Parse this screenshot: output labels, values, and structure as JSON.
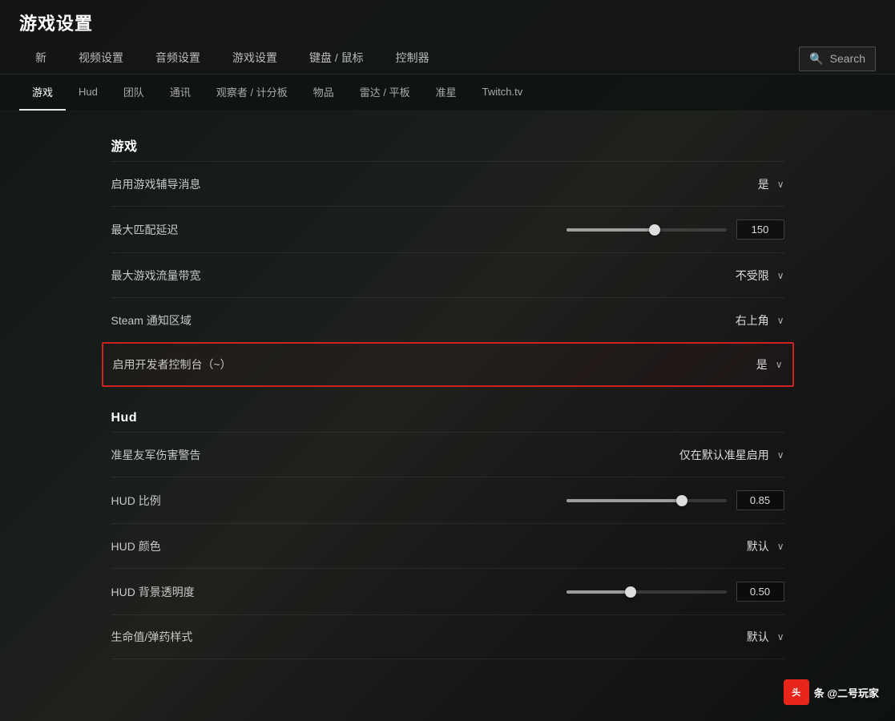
{
  "app": {
    "title": "游戏设置"
  },
  "nav": {
    "items": [
      {
        "id": "new",
        "label": "新"
      },
      {
        "id": "video",
        "label": "视频设置"
      },
      {
        "id": "audio",
        "label": "音频设置"
      },
      {
        "id": "game",
        "label": "游戏设置"
      },
      {
        "id": "keyboard",
        "label": "键盘 / 鼠标"
      },
      {
        "id": "controller",
        "label": "控制器"
      }
    ],
    "search_placeholder": "Search"
  },
  "sub_nav": {
    "items": [
      {
        "id": "game",
        "label": "游戏",
        "active": true
      },
      {
        "id": "hud",
        "label": "Hud"
      },
      {
        "id": "team",
        "label": "团队"
      },
      {
        "id": "comms",
        "label": "通讯"
      },
      {
        "id": "observer",
        "label": "观察者 / 计分板"
      },
      {
        "id": "items",
        "label": "物品"
      },
      {
        "id": "radar",
        "label": "雷达 / 平板"
      },
      {
        "id": "crosshair",
        "label": "准星"
      },
      {
        "id": "twitch",
        "label": "Twitch.tv"
      }
    ]
  },
  "sections": [
    {
      "id": "game-section",
      "header": "游戏",
      "rows": [
        {
          "id": "game-assistant",
          "label": "启用游戏辅导消息",
          "type": "dropdown",
          "value": "是",
          "highlighted": false
        },
        {
          "id": "max-matchmaking-delay",
          "label": "最大匹配延迟",
          "type": "slider",
          "slider_fill_pct": 55,
          "slider_thumb_pct": 55,
          "value": "150",
          "highlighted": false
        },
        {
          "id": "max-game-bandwidth",
          "label": "最大游戏流量带宽",
          "type": "dropdown",
          "value": "不受限",
          "highlighted": false
        },
        {
          "id": "steam-notification",
          "label": "Steam 通知区域",
          "type": "dropdown",
          "value": "右上角",
          "highlighted": false
        },
        {
          "id": "developer-console",
          "label": "启用开发者控制台（~）",
          "type": "dropdown",
          "value": "是",
          "highlighted": true
        }
      ]
    },
    {
      "id": "hud-section",
      "header": "Hud",
      "rows": [
        {
          "id": "crosshair-warning",
          "label": "准星友军伤害警告",
          "type": "dropdown",
          "value": "仅在默认准星启用",
          "highlighted": false
        },
        {
          "id": "hud-scale",
          "label": "HUD 比例",
          "type": "slider",
          "slider_fill_pct": 72,
          "slider_thumb_pct": 72,
          "value": "0.85",
          "highlighted": false
        },
        {
          "id": "hud-color",
          "label": "HUD 颜色",
          "type": "dropdown",
          "value": "默认",
          "highlighted": false
        },
        {
          "id": "hud-bg-transparency",
          "label": "HUD 背景透明度",
          "type": "slider",
          "slider_fill_pct": 40,
          "slider_thumb_pct": 40,
          "value": "0.50",
          "highlighted": false
        },
        {
          "id": "health-ammo-style",
          "label": "生命值/弹药样式",
          "type": "dropdown",
          "value": "默认",
          "highlighted": false
        }
      ]
    }
  ],
  "watermark": {
    "icon": "头",
    "text": "条 @二号玩家"
  },
  "icons": {
    "search": "🔍",
    "chevron_down": "∨"
  }
}
